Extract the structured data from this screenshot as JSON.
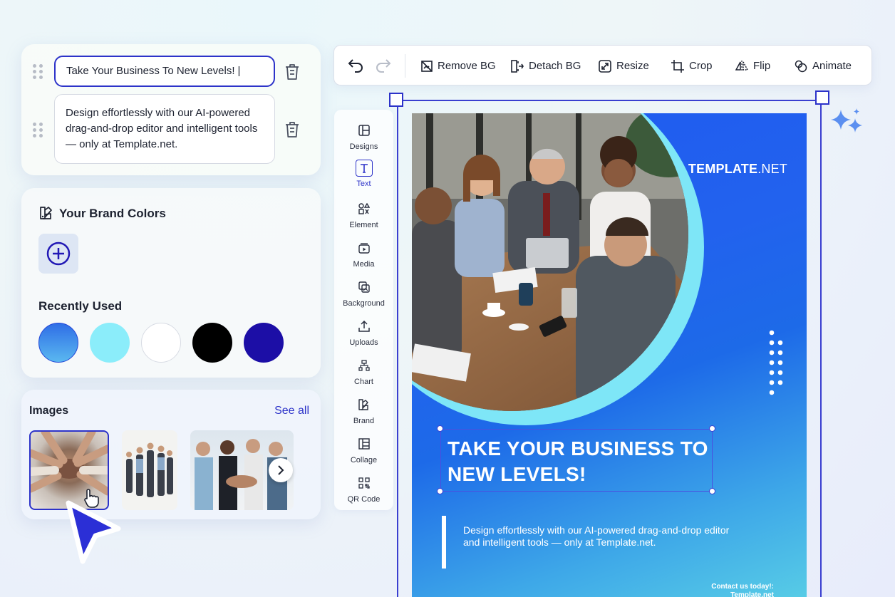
{
  "text_panel": {
    "title_value": "Take Your Business To New Levels!",
    "description_value": "Design effortlessly with our AI-powered drag-and-drop editor and intelligent tools — only at Template.net."
  },
  "brand_colors": {
    "title": "Your Brand Colors",
    "recently_used_title": "Recently Used",
    "swatches": [
      {
        "name": "blue-gradient",
        "color": "#2f86e6"
      },
      {
        "name": "light-cyan",
        "color": "#8bedfa"
      },
      {
        "name": "white",
        "color": "#ffffff"
      },
      {
        "name": "black",
        "color": "#000000"
      },
      {
        "name": "dark-indigo",
        "color": "#1c0ea6"
      }
    ]
  },
  "images": {
    "title": "Images",
    "see_all": "See all"
  },
  "toolbar": {
    "remove_bg": "Remove BG",
    "detach_bg": "Detach BG",
    "resize": "Resize",
    "crop": "Crop",
    "flip": "Flip",
    "animate": "Animate"
  },
  "tools": [
    {
      "label": "Designs",
      "icon": "layout-icon"
    },
    {
      "label": "Text",
      "icon": "text-icon"
    },
    {
      "label": "Element",
      "icon": "shapes-icon"
    },
    {
      "label": "Media",
      "icon": "media-icon"
    },
    {
      "label": "Background",
      "icon": "background-icon"
    },
    {
      "label": "Uploads",
      "icon": "upload-icon"
    },
    {
      "label": "Chart",
      "icon": "chart-icon"
    },
    {
      "label": "Brand",
      "icon": "brand-icon"
    },
    {
      "label": "Collage",
      "icon": "collage-icon"
    },
    {
      "label": "QR Code",
      "icon": "qr-code-icon"
    }
  ],
  "poster": {
    "brand_bold": "TEMPLATE",
    "brand_light": ".NET",
    "headline": "TAKE YOUR BUSINESS TO NEW LEVELS!",
    "description": "Design effortlessly with our AI-powered drag-and-drop editor and intelligent tools — only at Template.net.",
    "contact_line1": "Contact us today!:",
    "contact_line2": "Template.net"
  },
  "colors": {
    "accent": "#2d33c9",
    "poster_blue": "#1f5af0",
    "poster_cyan": "#5ad0e6"
  }
}
